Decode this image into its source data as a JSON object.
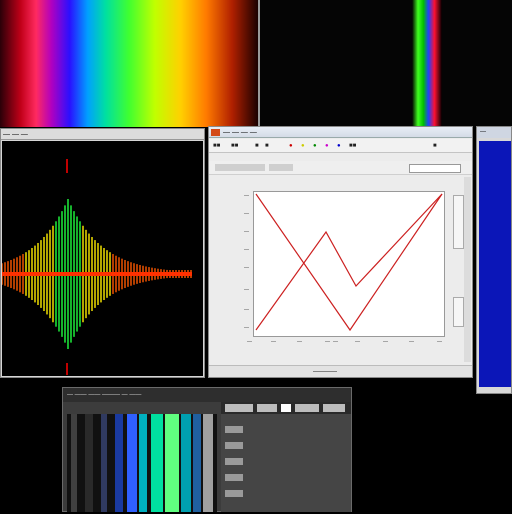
{
  "spectrum": {
    "label": ""
  },
  "wave_window": {
    "title": "— — —"
  },
  "plot_window": {
    "title": "— — — —",
    "toolbar_items": [
      "■■",
      "■■",
      "■",
      "■",
      "●",
      "●",
      "●",
      "●",
      "●",
      "■■",
      "■"
    ],
    "y_ticks": [
      "—",
      "—",
      "—",
      "—",
      "—",
      "—",
      "—",
      "—"
    ],
    "x_ticks": [
      "—",
      "—",
      "—",
      "—",
      "—",
      "—",
      "—",
      "—",
      "—"
    ],
    "status": "————",
    "line_color": "#cc2020"
  },
  "blue_window": {
    "title": "—"
  },
  "bottom_window": {
    "menu": "— —— —— ——— — ——"
  },
  "colors": {
    "accent": "#d34a18",
    "wave_green": "#40ff30",
    "wave_yellow": "#ffee00",
    "wave_red": "#ff2000",
    "blue_pane": "#0b16b8"
  }
}
